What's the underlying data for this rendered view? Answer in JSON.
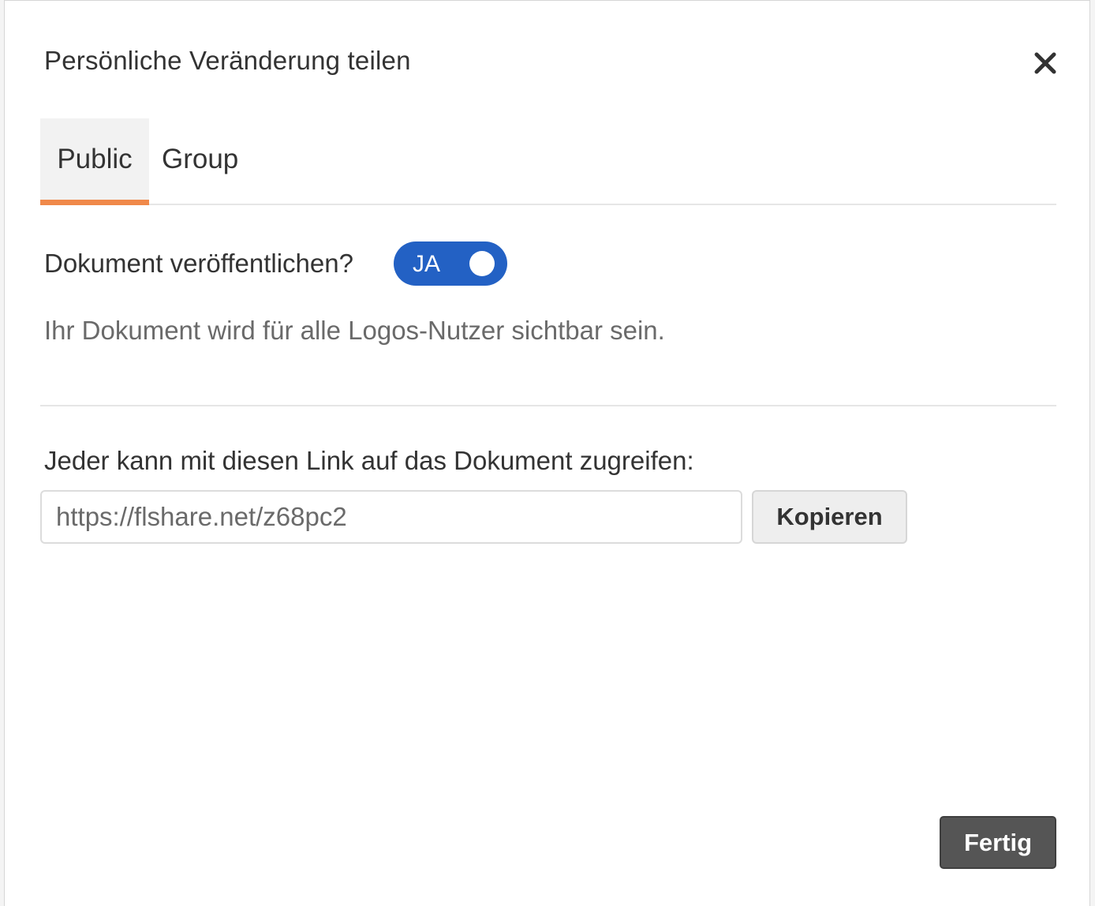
{
  "dialog": {
    "title": "Persönliche Veränderung teilen",
    "close_icon": "close-icon"
  },
  "tabs": [
    {
      "label": "Public",
      "active": true
    },
    {
      "label": "Group",
      "active": false
    }
  ],
  "publish": {
    "label": "Dokument veröffentlichen?",
    "toggle_text": "JA",
    "toggle_on": true,
    "description": "Ihr Dokument wird für alle Logos-Nutzer sichtbar sein."
  },
  "share_link": {
    "label": "Jeder kann mit diesen Link auf das Dokument zugreifen:",
    "url": "https://flshare.net/z68pc2",
    "copy_label": "Kopieren"
  },
  "footer": {
    "done_label": "Fertig"
  },
  "colors": {
    "accent_tab": "#f0894a",
    "toggle_bg": "#2361c4",
    "done_button_bg": "#555555"
  }
}
